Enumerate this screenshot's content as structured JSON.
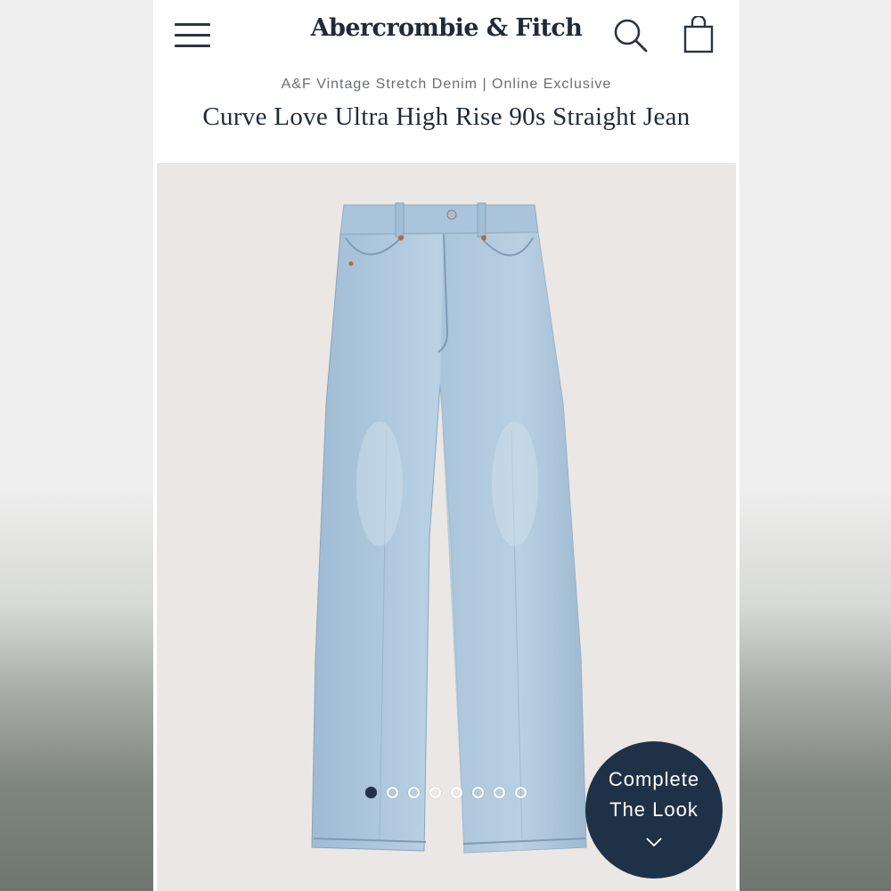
{
  "header": {
    "brand": "Abercrombie & Fitch",
    "menu_icon": "hamburger-menu-icon",
    "search_icon": "search-icon",
    "bag_icon": "shopping-bag-icon"
  },
  "product": {
    "collection": "A&F Vintage Stretch Denim | Online Exclusive",
    "title": "Curve Love Ultra High Rise 90s Straight Jean",
    "image_alt": "light wash straight leg jeans"
  },
  "carousel": {
    "total": 8,
    "active": 1
  },
  "complete_look": {
    "line1": "Complete",
    "line2": "The Look",
    "icon": "chevron-down-icon"
  },
  "colors": {
    "brand_navy": "#1f3147",
    "denim": "#a9c6dd",
    "image_bg": "#ebe7e4"
  }
}
